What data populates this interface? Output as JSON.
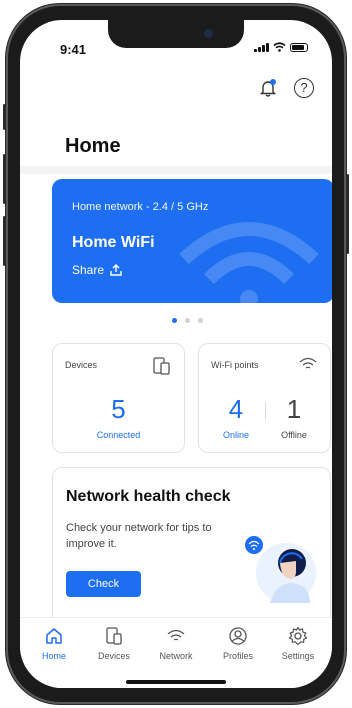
{
  "status_bar": {
    "time": "9:41"
  },
  "page": {
    "title": "Home"
  },
  "network_card": {
    "network_label": "Home network - 2.4 / 5 GHz",
    "wifi_name": "Home WiFi",
    "share_label": "Share"
  },
  "carousel": {
    "page_count": 3,
    "active_index": 0
  },
  "devices_card": {
    "title": "Devices",
    "count": "5",
    "count_label": "Connected"
  },
  "wifi_points_card": {
    "title": "Wi-Fi points",
    "online_count": "4",
    "online_label": "Online",
    "offline_count": "1",
    "offline_label": "Offline"
  },
  "health_check": {
    "title": "Network health check",
    "description": "Check your network for tips to improve it.",
    "button_label": "Check"
  },
  "tab_bar": {
    "tabs": [
      {
        "label": "Home",
        "icon": "home-icon",
        "active": true
      },
      {
        "label": "Devices",
        "icon": "devices-icon",
        "active": false
      },
      {
        "label": "Network",
        "icon": "wifi-icon",
        "active": false
      },
      {
        "label": "Profiles",
        "icon": "profile-icon",
        "active": false
      },
      {
        "label": "Settings",
        "icon": "gear-icon",
        "active": false
      }
    ]
  },
  "colors": {
    "accent": "#1e6ef2",
    "notification_dot": "#1e6ef2"
  }
}
